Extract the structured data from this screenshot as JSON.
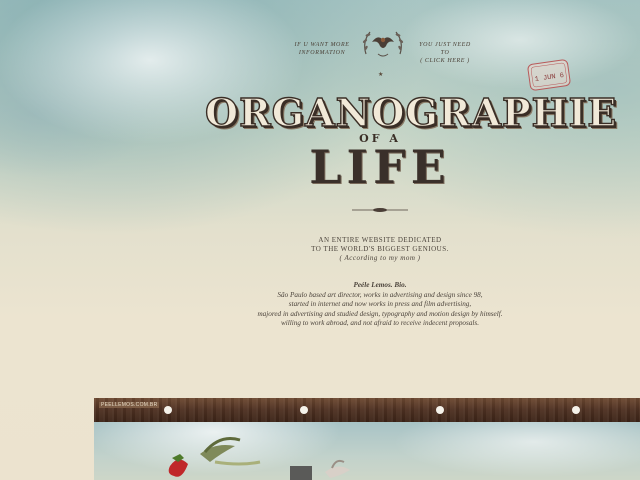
{
  "header": {
    "nav_left_line1": "IF U WANT MORE",
    "nav_left_line2": "INFORMATION",
    "nav_right_line1": "YOU JUST NEED TO",
    "nav_right_line2": "( CLICK HERE )",
    "emblem_icon": "bird-crest-icon",
    "stamp_text": "1 JUN 6"
  },
  "title": {
    "main": "ORGANOGRAPHIE",
    "of_a": "OF A",
    "life": "LIFE"
  },
  "tagline": {
    "line1": "AN ENTIRE WEBSITE DEDICATED",
    "line2": "TO THE WORLD'S BIGGEST GENIOUS.",
    "line3": "( According to my mom )"
  },
  "bio": {
    "name": "Peéle Lemos. Bio.",
    "line1": "São Paulo based art director, works in advertising and design since 98,",
    "line2": "started in internet and now works in press and film advertising,",
    "line3": "majored in advertising and studied design, typography and motion design by himself.",
    "line4": "willing to work abroad, and not afraid to receive indecent proposals."
  },
  "gallery": {
    "label": "PEELLEMOS.COM.BR"
  },
  "colors": {
    "ink": "#3a2e26",
    "wood": "#4e3122",
    "paper": "#ece3cf"
  }
}
